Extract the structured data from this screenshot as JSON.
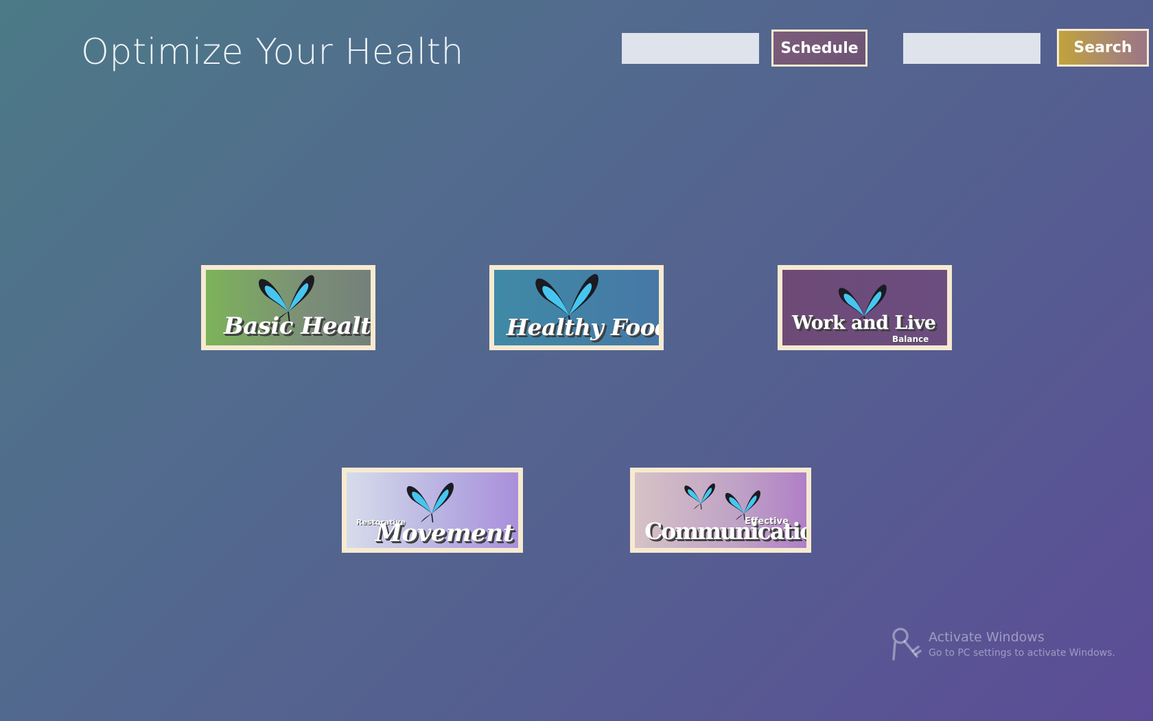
{
  "header": {
    "title": "Optimize Your Health"
  },
  "schedule": {
    "input_value": "",
    "button_label": "Schedule"
  },
  "search": {
    "input_value": "",
    "button_label": "Search"
  },
  "tiles": [
    {
      "label": "Basic Health",
      "sub": "",
      "icon": "butterfly-icon"
    },
    {
      "label": "Healthy Food",
      "sub": "",
      "icon": "butterfly-icon"
    },
    {
      "label": "Work and Live",
      "sub": "Balance",
      "icon": "butterfly-icon"
    },
    {
      "label": "Movement",
      "sub": "Restorative",
      "icon": "butterfly-icon"
    },
    {
      "label": "Communication",
      "sub": "Effective",
      "icon": "butterfly-icon"
    }
  ],
  "watermark": {
    "title": "Activate Windows",
    "subtitle": "Go to PC settings to activate Windows.",
    "icon": "key-icon"
  },
  "colors": {
    "tile_border": "#f7ead1",
    "schedule_button": "#7c5d7a",
    "search_button": "#c1a33c",
    "butterfly_blue": "#46c6ef"
  }
}
